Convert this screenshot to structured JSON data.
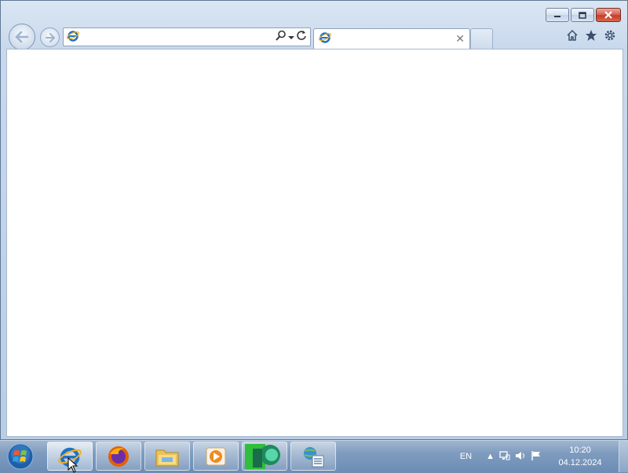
{
  "browser": {
    "address_value": "",
    "address_placeholder": "",
    "tab_title": "",
    "icons": {
      "back": "back-arrow-icon",
      "forward": "forward-arrow-icon",
      "search": "search-icon",
      "refresh": "refresh-icon",
      "home": "home-icon",
      "favorites": "star-icon",
      "tools": "gear-icon"
    }
  },
  "window_controls": [
    "minimize",
    "maximize",
    "close"
  ],
  "taskbar": {
    "pinned": [
      "internet-explorer",
      "firefox",
      "file-explorer",
      "media-player",
      "app-green",
      "network-app"
    ],
    "language": "EN",
    "time": "10:20",
    "date": "04.12.2024"
  },
  "colors": {
    "ie_blue": "#1e73c8",
    "ie_ring": "#f2b01e",
    "close_red": "#c63b2b"
  }
}
